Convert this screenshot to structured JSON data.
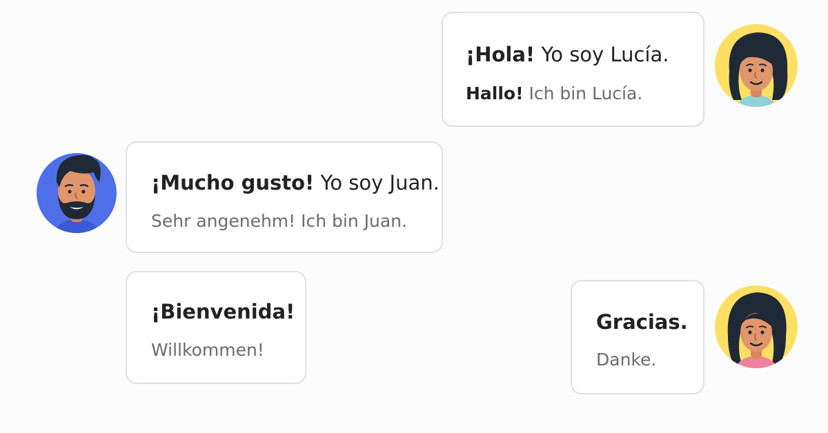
{
  "messages": [
    {
      "speaker": "Lucía",
      "es_bold": "¡Hola!",
      "es_rest": " Yo soy Lucía.",
      "de_bold": "Hallo!",
      "de_rest": " Ich bin Lucía."
    },
    {
      "speaker": "Juan",
      "es_bold": "¡Mucho gusto!",
      "es_rest": " Yo soy Juan.",
      "de_bold": "",
      "de_rest": "Sehr angenehm! Ich bin Juan."
    },
    {
      "speaker": "Juan",
      "es_bold": "¡Bienvenida!",
      "es_rest": "",
      "de_bold": "",
      "de_rest": "Willkommen!"
    },
    {
      "speaker": "Lucía",
      "es_bold": "Gracias.",
      "es_rest": "",
      "de_bold": "",
      "de_rest": "Danke."
    }
  ],
  "avatars": {
    "lucia": {
      "icon": "woman-avatar-icon",
      "background": "#fde063",
      "hair": "#1f2a36",
      "skin": "#e0956a",
      "shirt": "#8ed1d6"
    },
    "juan": {
      "icon": "bearded-man-avatar-icon",
      "background": "#4f6fe8",
      "hair": "#1f2a36",
      "skin": "#e0956a",
      "shirt": "#3b5bd6"
    },
    "lucia_2": {
      "icon": "woman-avatar-icon",
      "background": "#fde063",
      "hair": "#1f2a36",
      "skin": "#e0956a",
      "shirt": "#f07fa0"
    }
  },
  "colors": {
    "bubble_border": "#dde1e4",
    "text_primary": "#222222",
    "text_secondary": "#6b6b6b"
  }
}
